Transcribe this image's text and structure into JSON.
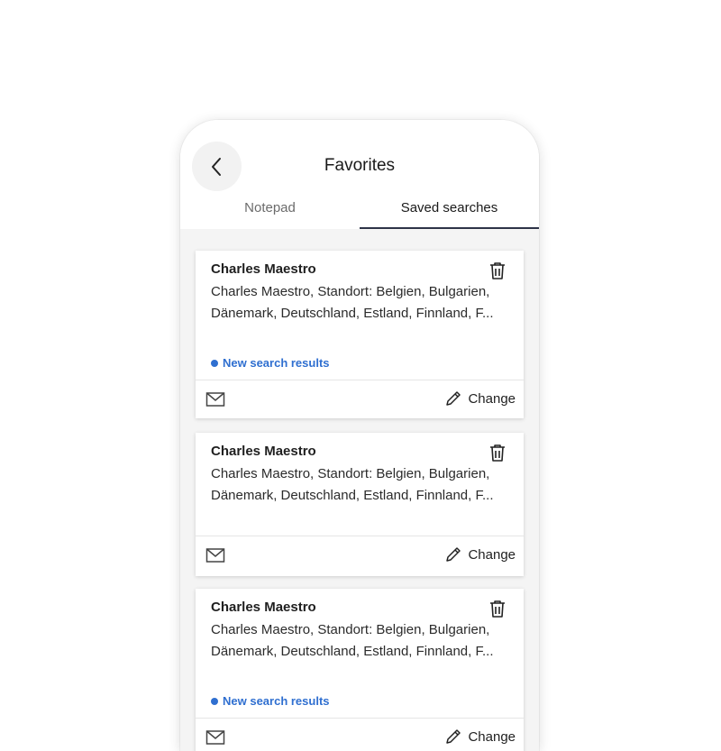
{
  "header": {
    "title": "Favorites",
    "back_icon": "chevron-left-icon"
  },
  "tabs": [
    {
      "label": "Notepad",
      "active": false
    },
    {
      "label": "Saved searches",
      "active": true
    }
  ],
  "cards": [
    {
      "title": "Charles Maestro",
      "line1": "Charles Maestro, Standort: Belgien, Bulgarien,",
      "line2": "Dänemark, Deutschland, Estland, Finnland, F...",
      "new_results": "New search results",
      "change_label": "Change"
    },
    {
      "title": "Charles Maestro",
      "line1": "Charles Maestro, Standort: Belgien, Bulgarien,",
      "line2": "Dänemark, Deutschland, Estland, Finnland, F...",
      "change_label": "Change"
    },
    {
      "title": "Charles Maestro",
      "line1": "Charles Maestro, Standort: Belgien, Bulgarien,",
      "line2": "Dänemark, Deutschland, Estland, Finnland, F...",
      "new_results": "New search results",
      "change_label": "Change"
    }
  ],
  "colors": {
    "accent": "#2f6fd0",
    "tab_indicator": "#2d3347"
  }
}
